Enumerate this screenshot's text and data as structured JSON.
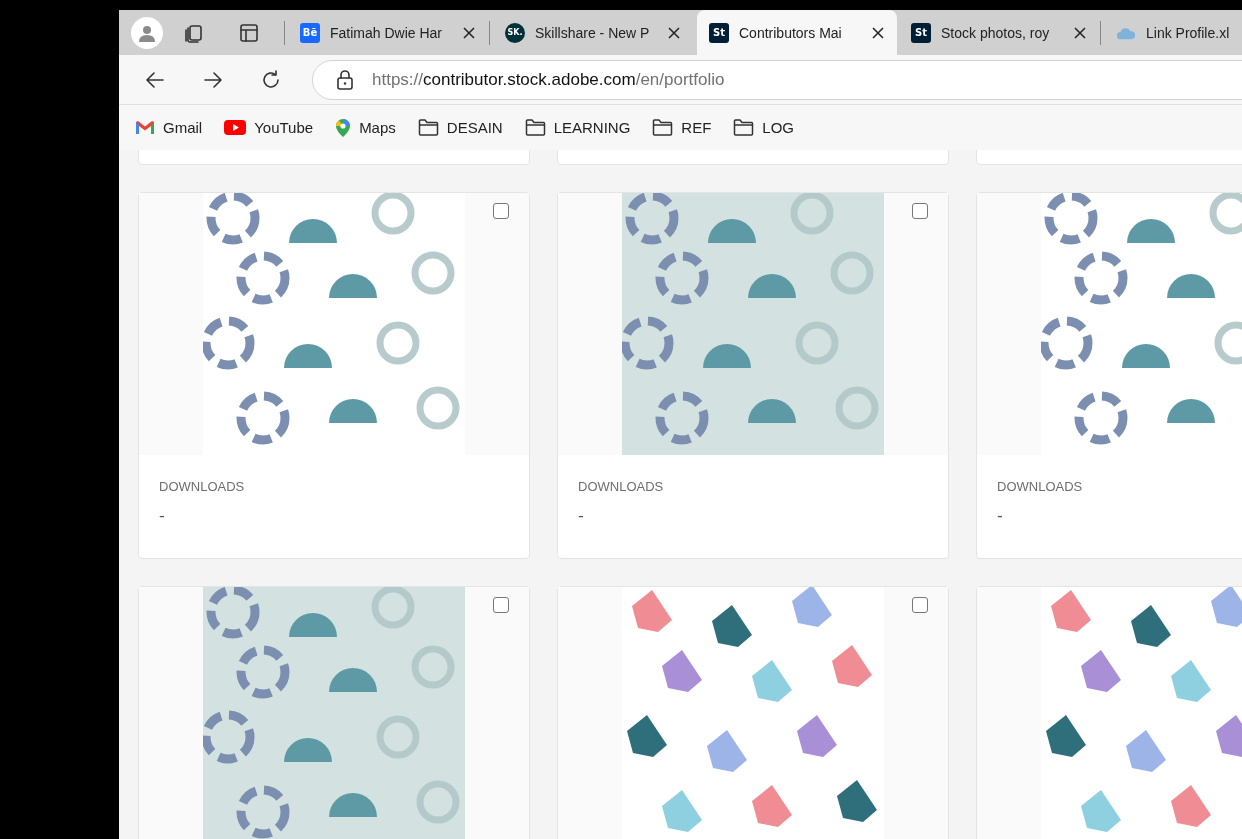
{
  "tabs": [
    {
      "kind": "behance",
      "icon_text": "Bē",
      "title": "Fatimah Dwie Har",
      "selected": false
    },
    {
      "kind": "skillshare",
      "icon_text": "SK.",
      "title": "Skillshare - New P",
      "selected": false
    },
    {
      "kind": "stock",
      "icon_text": "St",
      "title": "Contributors Mai",
      "selected": true
    },
    {
      "kind": "stock",
      "icon_text": "St",
      "title": "Stock photos, roy",
      "selected": false
    },
    {
      "kind": "cloud",
      "title": "Link Profile.xl",
      "selected": false
    }
  ],
  "address_bar": {
    "scheme": "https://",
    "host": "contributor.stock.adobe.com",
    "path": "/en/portfolio"
  },
  "bookmarks": [
    {
      "kind": "gmail",
      "label": "Gmail"
    },
    {
      "kind": "youtube",
      "label": "YouTube"
    },
    {
      "kind": "maps",
      "label": "Maps"
    },
    {
      "kind": "folder",
      "label": "DESAIN"
    },
    {
      "kind": "folder",
      "label": "LEARNING"
    },
    {
      "kind": "folder",
      "label": "REF"
    },
    {
      "kind": "folder",
      "label": "LOG"
    }
  ],
  "cards": [
    {
      "kind": "edge"
    },
    {
      "kind": "edge"
    },
    {
      "kind": "edge"
    },
    {
      "kind": "asset",
      "checked": false,
      "downloads_label": "DOWNLOADS",
      "downloads": "-"
    },
    {
      "kind": "asset",
      "checked": false,
      "downloads_label": "DOWNLOADS",
      "downloads": "-"
    },
    {
      "kind": "asset",
      "downloads_label": "DOWNLOADS",
      "downloads": "-"
    },
    {
      "kind": "asset",
      "checked": false
    },
    {
      "kind": "asset",
      "checked": false
    },
    {
      "kind": "asset"
    }
  ]
}
